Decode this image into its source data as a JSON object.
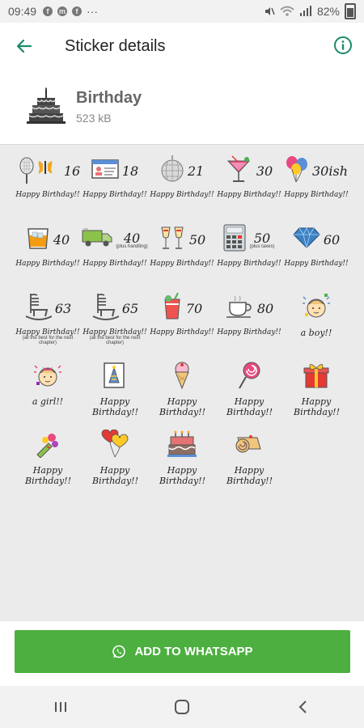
{
  "status_bar": {
    "time": "09:49",
    "battery": "82%",
    "more": "···"
  },
  "app_bar": {
    "title": "Sticker details"
  },
  "pack": {
    "name": "Birthday",
    "size": "523 kB"
  },
  "stickers": [
    {
      "num": "16",
      "text": "Happy Birthday!!",
      "icon": "tennis-racket-butterfly"
    },
    {
      "num": "18",
      "text": "Happy Birthday!!",
      "icon": "id-card"
    },
    {
      "num": "21",
      "text": "Happy Birthday!!",
      "icon": "disco-ball"
    },
    {
      "num": "30",
      "text": "Happy Birthday!!",
      "icon": "cocktail"
    },
    {
      "num": "30ish",
      "text": "Happy Birthday!!",
      "icon": "balloons"
    },
    {
      "num": "40",
      "text": "Happy Birthday!!",
      "icon": "whisky-glass"
    },
    {
      "num": "40",
      "sub": "(plus handling)",
      "text": "Happy Birthday!!",
      "icon": "truck"
    },
    {
      "num": "50",
      "text": "Happy Birthday!!",
      "icon": "champagne-glasses"
    },
    {
      "num": "50",
      "sub": "(plus taxes)",
      "text": "Happy Birthday!!",
      "icon": "calculator"
    },
    {
      "num": "60",
      "text": "Happy Birthday!!",
      "icon": "diamond"
    },
    {
      "num": "63",
      "text": "Happy Birthday!!",
      "sub2": "(all the best for the next chapter)",
      "icon": "rocking-chair"
    },
    {
      "num": "65",
      "text": "Happy Birthday!!",
      "sub2": "(all the best for the next chapter)",
      "icon": "rocking-chair"
    },
    {
      "num": "70",
      "text": "Happy Birthday!!",
      "icon": "juice-drink"
    },
    {
      "num": "80",
      "text": "Happy Birthday!!",
      "icon": "tea-cup"
    },
    {
      "text": "a boy!!",
      "icon": "baby-boy"
    },
    {
      "text": "a girl!!",
      "icon": "baby-girl"
    },
    {
      "text": "Happy Birthday!!",
      "icon": "birthday-card"
    },
    {
      "text": "Happy Birthday!!",
      "icon": "ice-cream"
    },
    {
      "text": "Happy Birthday!!",
      "icon": "lollipop"
    },
    {
      "text": "Happy Birthday!!",
      "icon": "gift-box"
    },
    {
      "text": "Happy Birthday!!",
      "icon": "flower-bouquet"
    },
    {
      "text": "Happy Birthday!!",
      "icon": "heart-balloons"
    },
    {
      "text": "Happy Birthday!!",
      "icon": "birthday-cake"
    },
    {
      "text": "Happy Birthday!!",
      "icon": "cake-roll"
    }
  ],
  "add_button": {
    "label": "ADD TO WHATSAPP"
  },
  "colors": {
    "accent": "#4caf3f",
    "grid_bg": "#ebebeb",
    "toolbar_icon": "#1a8a6a"
  }
}
